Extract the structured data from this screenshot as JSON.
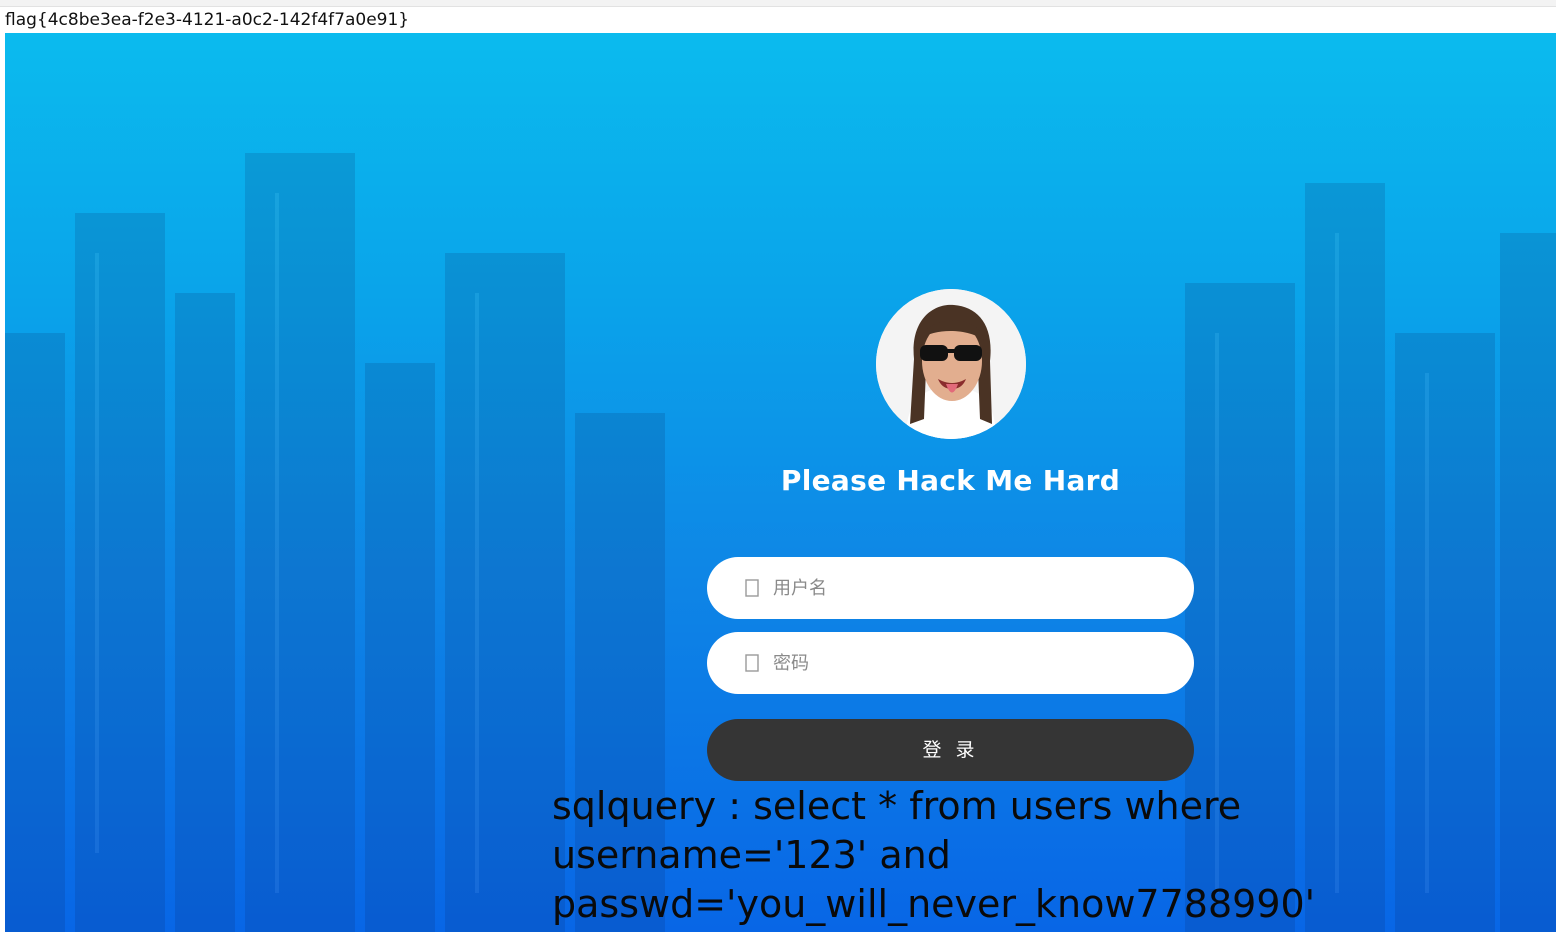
{
  "flag_text": "flag{4c8be3ea-f2e3-4121-a0c2-142f4f7a0e91}",
  "login": {
    "title": "Please Hack Me Hard",
    "username_placeholder": "用户名",
    "password_placeholder": "密码",
    "submit_label": "登 录",
    "username_icon": "user-icon",
    "password_icon": "lock-icon"
  },
  "sqlquery": {
    "line1": "sqlquery : select * from users where",
    "line2": "username='123' and",
    "line3": "passwd='you_will_never_know7788990'"
  },
  "colors": {
    "bg_top": "#0bbbee",
    "bg_bottom": "#0866e6",
    "button": "#353535",
    "input_bg": "#ffffff",
    "title": "#ffffff"
  }
}
